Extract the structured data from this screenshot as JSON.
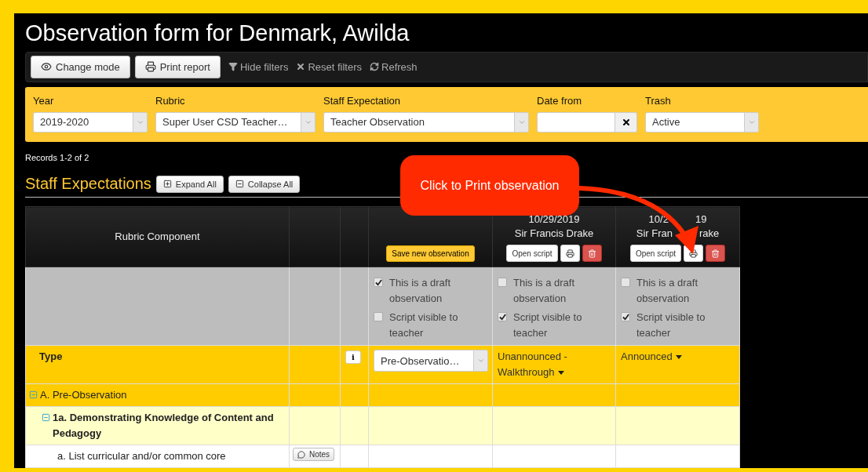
{
  "title": "Observation form for Denmark, Awilda",
  "toolbar": {
    "buttons": [
      {
        "kind": "eye",
        "label": "Change mode"
      },
      {
        "kind": "print",
        "label": "Print report"
      }
    ],
    "links": [
      {
        "kind": "filter",
        "label": "Hide filters"
      },
      {
        "kind": "reset",
        "label": "Reset filters"
      },
      {
        "kind": "refresh",
        "label": "Refresh"
      }
    ]
  },
  "filters": [
    {
      "kind": "select",
      "label": "Year",
      "value": "2019-2020"
    },
    {
      "kind": "select",
      "label": "Rubric",
      "value": "Super User CSD Teacher…"
    },
    {
      "kind": "select",
      "label": "Staff Expectation",
      "value": "Teacher Observation"
    },
    {
      "kind": "date",
      "label": "Date from"
    },
    {
      "kind": "select",
      "label": "Trash",
      "value": "Active"
    }
  ],
  "records": "Records 1-2 of 2",
  "section": {
    "title": "Staff Expectations",
    "buttons": [
      {
        "kind": "expand",
        "label": "Expand All"
      },
      {
        "kind": "collapse",
        "label": "Collapse All"
      }
    ]
  },
  "table": {
    "component_header": "Rubric Component",
    "observations": [
      {
        "kind": "new",
        "action": "Save new observation",
        "checks": [
          {
            "label": "This is a draft observation",
            "checked": true
          },
          {
            "label": "Script visible to teacher",
            "checked": false
          }
        ],
        "type": {
          "kind": "select",
          "value": "Pre-Observatio…"
        }
      },
      {
        "kind": "saved",
        "date": [
          "10/29/2019"
        ],
        "observer": [
          "Sir Francis Drake"
        ],
        "open": "Open script",
        "checks": [
          {
            "label": "This is a draft observation",
            "checked": false
          },
          {
            "label": "Script visible to teacher",
            "checked": true
          }
        ],
        "type": {
          "kind": "dropdown",
          "value": "Unannounced - Walkthrough"
        }
      },
      {
        "kind": "saved",
        "date": [
          "10/2",
          "19"
        ],
        "observer": [
          "Sir Fran",
          "rake"
        ],
        "open": "Open script",
        "checks": [
          {
            "label": "This is a draft observation",
            "checked": false
          },
          {
            "label": "Script visible to teacher",
            "checked": true
          }
        ],
        "type": {
          "kind": "dropdown",
          "value": "Announced"
        }
      }
    ],
    "type_label": "Type",
    "info": "i",
    "rows": [
      {
        "kind": "group",
        "label": "A. Pre-Observation",
        "expanded": true
      },
      {
        "kind": "component",
        "label": "1a. Demonstrating Knowledge of Content and Pedagogy",
        "expanded": true
      },
      {
        "kind": "item",
        "label": "a. List curricular and/or common core",
        "notes": "Notes"
      }
    ]
  },
  "callout": {
    "text": "Click to Print observation"
  }
}
